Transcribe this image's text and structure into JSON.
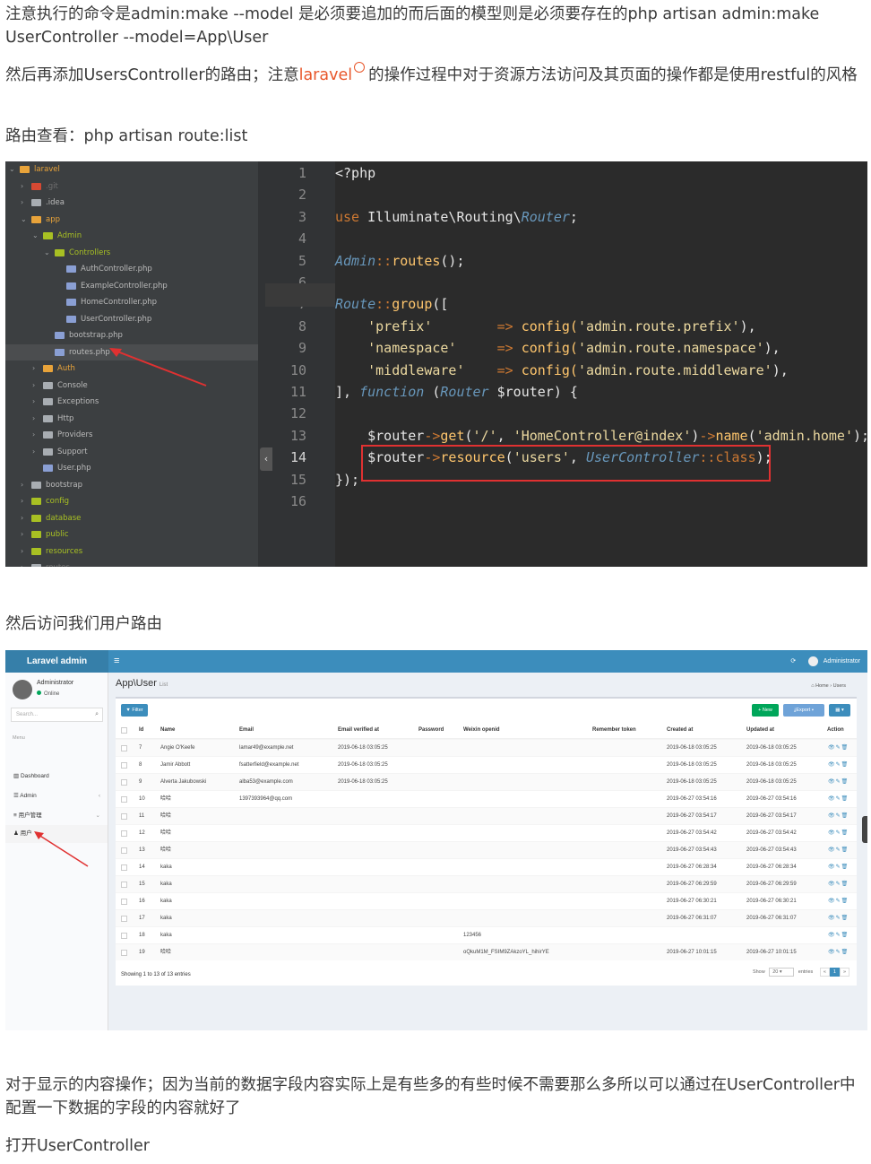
{
  "article": {
    "p1": "注意执行的命令是admin:make --model 是必须要追加的而后面的模型则是必须要存在的php artisan admin:make UserController --model=App\\User",
    "p2_before": "然后再添加UsersController的路由；注意",
    "p2_link": "laravel",
    "p2_after": "的操作过程中对于资源方法访问及其页面的操作都是使用restful的风格",
    "p3": "路由查看：php artisan route:list",
    "p4": "然后访问我们用户路由",
    "p5": "对于显示的内容操作；因为当前的数据字段内容实际上是有些多的有些时候不需要那么多所以可以通过在UserController中配置一下数据的字段的内容就好了",
    "p6": "打开UserController",
    "link_color": "#e8572b"
  },
  "ide": {
    "tree": [
      {
        "label": "laravel",
        "depth": 0,
        "arrow": "⌄",
        "icon": "project-icon",
        "color": "#e8a33a"
      },
      {
        "label": ".git",
        "depth": 1,
        "arrow": "›",
        "icon": "git-icon",
        "color": "#d64933",
        "dim": true
      },
      {
        "label": ".idea",
        "depth": 1,
        "arrow": "›",
        "icon": "folder-icon",
        "color": "#a8adb2"
      },
      {
        "label": "app",
        "depth": 1,
        "arrow": "⌄",
        "icon": "folder-icon",
        "color": "#e8a33a"
      },
      {
        "label": "Admin",
        "depth": 2,
        "arrow": "⌄",
        "icon": "folder-icon",
        "color": "#a8c023"
      },
      {
        "label": "Controllers",
        "depth": 3,
        "arrow": "⌄",
        "icon": "folder-icon",
        "color": "#a8c023"
      },
      {
        "label": "AuthController.php",
        "depth": 4,
        "arrow": "",
        "icon": "php-icon",
        "color": "#8a9fd4"
      },
      {
        "label": "ExampleController.php",
        "depth": 4,
        "arrow": "",
        "icon": "php-icon",
        "color": "#8a9fd4"
      },
      {
        "label": "HomeController.php",
        "depth": 4,
        "arrow": "",
        "icon": "php-icon",
        "color": "#8a9fd4"
      },
      {
        "label": "UserController.php",
        "depth": 4,
        "arrow": "",
        "icon": "php-icon",
        "color": "#8a9fd4"
      },
      {
        "label": "bootstrap.php",
        "depth": 3,
        "arrow": "",
        "icon": "php-icon",
        "color": "#8a9fd4"
      },
      {
        "label": "routes.php",
        "depth": 3,
        "arrow": "",
        "icon": "php-icon",
        "color": "#8a9fd4",
        "selected": true
      },
      {
        "label": "Auth",
        "depth": 2,
        "arrow": "›",
        "icon": "folder-icon",
        "color": "#e8a33a"
      },
      {
        "label": "Console",
        "depth": 2,
        "arrow": "›",
        "icon": "folder-icon",
        "color": "#a8adb2"
      },
      {
        "label": "Exceptions",
        "depth": 2,
        "arrow": "›",
        "icon": "folder-icon",
        "color": "#a8adb2"
      },
      {
        "label": "Http",
        "depth": 2,
        "arrow": "›",
        "icon": "folder-icon",
        "color": "#a8adb2"
      },
      {
        "label": "Providers",
        "depth": 2,
        "arrow": "›",
        "icon": "folder-icon",
        "color": "#a8adb2"
      },
      {
        "label": "Support",
        "depth": 2,
        "arrow": "›",
        "icon": "folder-icon",
        "color": "#a8adb2"
      },
      {
        "label": "User.php",
        "depth": 2,
        "arrow": "",
        "icon": "php-icon",
        "color": "#8a9fd4"
      },
      {
        "label": "bootstrap",
        "depth": 1,
        "arrow": "›",
        "icon": "folder-icon",
        "color": "#a8adb2"
      },
      {
        "label": "config",
        "depth": 1,
        "arrow": "›",
        "icon": "folder-icon",
        "color": "#a8c023"
      },
      {
        "label": "database",
        "depth": 1,
        "arrow": "›",
        "icon": "folder-icon",
        "color": "#a8c023"
      },
      {
        "label": "public",
        "depth": 1,
        "arrow": "›",
        "icon": "folder-icon",
        "color": "#a8c023"
      },
      {
        "label": "resources",
        "depth": 1,
        "arrow": "›",
        "icon": "folder-icon",
        "color": "#a8c023"
      },
      {
        "label": "routes",
        "depth": 1,
        "arrow": "›",
        "icon": "folder-icon",
        "color": "#a8adb2",
        "dim": true
      }
    ],
    "line_numbers": [
      "1",
      "2",
      "3",
      "4",
      "5",
      "6",
      "7",
      "8",
      "9",
      "10",
      "11",
      "12",
      "13",
      "14",
      "15",
      "16"
    ],
    "current_line": "14",
    "code_lines": [
      [
        {
          "t": "<?php",
          "c": ""
        }
      ],
      [],
      [
        {
          "t": "use ",
          "c": "kw"
        },
        {
          "t": "Illuminate\\Routing\\",
          "c": ""
        },
        {
          "t": "Router",
          "c": "cls"
        },
        {
          "t": ";",
          "c": ""
        }
      ],
      [],
      [
        {
          "t": "Admin",
          "c": "cls"
        },
        {
          "t": "::",
          "c": "op"
        },
        {
          "t": "routes",
          "c": "fn"
        },
        {
          "t": "();",
          "c": ""
        }
      ],
      [],
      [
        {
          "t": "Route",
          "c": "cls"
        },
        {
          "t": "::",
          "c": "op"
        },
        {
          "t": "group",
          "c": "fn"
        },
        {
          "t": "([",
          "c": ""
        }
      ],
      [
        {
          "t": "    ",
          "c": ""
        },
        {
          "t": "'prefix'",
          "c": "str"
        },
        {
          "t": "        ",
          "c": ""
        },
        {
          "t": "=>",
          "c": "op"
        },
        {
          "t": " config(",
          "c": "fn"
        },
        {
          "t": "'admin.route.prefix'",
          "c": "str"
        },
        {
          "t": "),",
          "c": ""
        }
      ],
      [
        {
          "t": "    ",
          "c": ""
        },
        {
          "t": "'namespace'",
          "c": "str"
        },
        {
          "t": "     ",
          "c": ""
        },
        {
          "t": "=>",
          "c": "op"
        },
        {
          "t": " config(",
          "c": "fn"
        },
        {
          "t": "'admin.route.namespace'",
          "c": "str"
        },
        {
          "t": "),",
          "c": ""
        }
      ],
      [
        {
          "t": "    ",
          "c": ""
        },
        {
          "t": "'middleware'",
          "c": "str"
        },
        {
          "t": "    ",
          "c": ""
        },
        {
          "t": "=>",
          "c": "op"
        },
        {
          "t": " config(",
          "c": "fn"
        },
        {
          "t": "'admin.route.middleware'",
          "c": "str"
        },
        {
          "t": "),",
          "c": ""
        }
      ],
      [
        {
          "t": "], ",
          "c": ""
        },
        {
          "t": "function",
          "c": "cls"
        },
        {
          "t": " (",
          "c": ""
        },
        {
          "t": "Router",
          "c": "cls"
        },
        {
          "t": " $router) {",
          "c": ""
        }
      ],
      [],
      [
        {
          "t": "    $router",
          "c": ""
        },
        {
          "t": "->",
          "c": "op"
        },
        {
          "t": "get",
          "c": "fn"
        },
        {
          "t": "(",
          "c": ""
        },
        {
          "t": "'/'",
          "c": "str"
        },
        {
          "t": ", ",
          "c": ""
        },
        {
          "t": "'HomeController@index'",
          "c": "str"
        },
        {
          "t": ")",
          "c": ""
        },
        {
          "t": "->",
          "c": "op"
        },
        {
          "t": "name",
          "c": "fn"
        },
        {
          "t": "(",
          "c": ""
        },
        {
          "t": "'admin.home'",
          "c": "str"
        },
        {
          "t": ");",
          "c": ""
        }
      ],
      [
        {
          "t": "    $router",
          "c": ""
        },
        {
          "t": "->",
          "c": "op"
        },
        {
          "t": "resource",
          "c": "fn"
        },
        {
          "t": "(",
          "c": ""
        },
        {
          "t": "'users'",
          "c": "str"
        },
        {
          "t": ", ",
          "c": ""
        },
        {
          "t": "UserController",
          "c": "cls"
        },
        {
          "t": "::",
          "c": "op"
        },
        {
          "t": "class",
          "c": "op"
        },
        {
          "t": ");",
          "c": ""
        }
      ],
      [
        {
          "t": "});",
          "c": ""
        }
      ],
      []
    ]
  },
  "admin": {
    "brand": "Laravel admin",
    "menu_icon": "hamburger-icon",
    "user": "Administrator",
    "status": "Online",
    "search_placeholder": "Search...",
    "menu_header": "Menu",
    "nav": [
      {
        "label": "Dashboard",
        "icon": "bar-chart-icon"
      },
      {
        "label": "Admin",
        "icon": "list-icon",
        "chev": "‹"
      },
      {
        "label": "用户管理",
        "icon": "bars-icon",
        "chev": "⌄"
      },
      {
        "label": "用户",
        "icon": "users-icon",
        "sub": true
      }
    ],
    "page_title": "App\\User",
    "page_sub": "List",
    "breadcrumb_home": "Home",
    "breadcrumb_current": "Users",
    "filter_label": "Filter",
    "new_label": "New",
    "export_label": "Export",
    "columns": [
      "Id",
      "Name",
      "Email",
      "Email verified at",
      "Password",
      "Weixin openid",
      "Remember token",
      "Created at",
      "Updated at",
      "Action"
    ],
    "rows": [
      [
        "7",
        "Angie O'Keefe",
        "lamar49@example.net",
        "2019-06-18 03:05:25",
        "",
        "",
        "",
        "2019-06-18 03:05:25",
        "2019-06-18 03:05:25"
      ],
      [
        "8",
        "Jamir Abbott",
        "fsatterfield@example.net",
        "2019-06-18 03:05:25",
        "",
        "",
        "",
        "2019-06-18 03:05:25",
        "2019-06-18 03:05:25"
      ],
      [
        "9",
        "Alverta Jakubowski",
        "alba53@example.com",
        "2019-06-18 03:05:25",
        "",
        "",
        "",
        "2019-06-18 03:05:25",
        "2019-06-18 03:05:25"
      ],
      [
        "10",
        "哈哈",
        "1397393964@qq.com",
        "",
        "",
        "",
        "",
        "2019-06-27 03:54:16",
        "2019-06-27 03:54:16"
      ],
      [
        "11",
        "哈哈",
        "",
        "",
        "",
        "",
        "",
        "2019-06-27 03:54:17",
        "2019-06-27 03:54:17"
      ],
      [
        "12",
        "哈哈",
        "",
        "",
        "",
        "",
        "",
        "2019-06-27 03:54:42",
        "2019-06-27 03:54:42"
      ],
      [
        "13",
        "哈哈",
        "",
        "",
        "",
        "",
        "",
        "2019-06-27 03:54:43",
        "2019-06-27 03:54:43"
      ],
      [
        "14",
        "kaka",
        "",
        "",
        "",
        "",
        "",
        "2019-06-27 06:28:34",
        "2019-06-27 06:28:34"
      ],
      [
        "15",
        "kaka",
        "",
        "",
        "",
        "",
        "",
        "2019-06-27 06:29:59",
        "2019-06-27 06:29:59"
      ],
      [
        "16",
        "kaka",
        "",
        "",
        "",
        "",
        "",
        "2019-06-27 06:30:21",
        "2019-06-27 06:30:21"
      ],
      [
        "17",
        "kaka",
        "",
        "",
        "",
        "",
        "",
        "2019-06-27 06:31:07",
        "2019-06-27 06:31:07"
      ],
      [
        "18",
        "kaka",
        "",
        "",
        "",
        "123456",
        "",
        "",
        ""
      ],
      [
        "19",
        "哈哈",
        "",
        "",
        "",
        "oQkuM1M_FSIM9ZAkzoYL_hihirYE",
        "",
        "2019-06-27 10:01:15",
        "2019-06-27 10:01:15"
      ]
    ],
    "footer": "Showing 1 to 13 of 13 entries",
    "show_label": "Show",
    "per_page": "20",
    "entries_label": "entries",
    "page": "1",
    "accent": "#3c8dbc"
  }
}
